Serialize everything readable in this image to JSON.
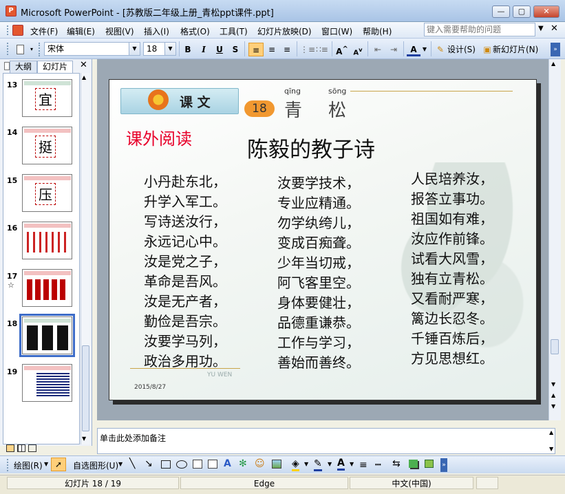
{
  "window": {
    "title": "Microsoft PowerPoint - [苏教版二年级上册_青松ppt课件.ppt]",
    "app_icon": "P"
  },
  "menu": {
    "items": [
      "文件(F)",
      "编辑(E)",
      "视图(V)",
      "插入(I)",
      "格式(O)",
      "工具(T)",
      "幻灯片放映(D)",
      "窗口(W)",
      "帮助(H)"
    ],
    "help_placeholder": "键入需要帮助的问题"
  },
  "toolbar": {
    "font": "宋体",
    "size": "18",
    "design_label": "设计(S)",
    "new_slide_label": "新幻灯片(N)"
  },
  "left_pane": {
    "tabs": [
      "大纲",
      "幻灯片"
    ],
    "thumbs": [
      {
        "num": "13",
        "glyph": "宜"
      },
      {
        "num": "14",
        "glyph": "挺"
      },
      {
        "num": "15",
        "glyph": "压"
      },
      {
        "num": "16",
        "glyph": ""
      },
      {
        "num": "17",
        "glyph": ""
      },
      {
        "num": "18",
        "glyph": ""
      },
      {
        "num": "19",
        "glyph": ""
      }
    ]
  },
  "slide": {
    "header_label": "课 文",
    "lesson_number": "18",
    "lesson_pinyin_1": "qīng",
    "lesson_pinyin_2": "sōng",
    "lesson_char_1": "青",
    "lesson_char_2": "松",
    "extra_reading": "课外阅读",
    "title": "陈毅的教子诗",
    "column1": [
      "小丹赴东北，",
      "升学入军工。",
      "写诗送汝行，",
      "永远记心中。",
      "汝是党之子，",
      "革命是吾风。",
      "汝是无产者，",
      "勤俭是吾宗。",
      "汝要学马列，",
      "政治多用功。"
    ],
    "column2": [
      "汝要学技术，",
      "专业应精通。",
      "勿学纨绔儿，",
      "变成百痴聋。",
      "少年当切戒，",
      "阿飞客里空。",
      "身体要健壮，",
      "品德重谦恭。",
      "工作与学习，",
      "善始而善终。"
    ],
    "column3": [
      "人民培养汝，",
      "报答立事功。",
      "祖国如有难，",
      "汝应作前锋。",
      "试看大风雪，",
      "独有立青松。",
      "又看耐严寒，",
      "篱边长忍冬。",
      "千锤百炼后，",
      "方见思想红。"
    ],
    "date": "2015/8/27",
    "footer": "YU WEN"
  },
  "notes": {
    "placeholder": "单击此处添加备注"
  },
  "draw_toolbar": {
    "draw_label": "绘图(R)",
    "autoshape_label": "自选图形(U)"
  },
  "status": {
    "slide_info": "幻灯片 18 / 19",
    "template": "Edge",
    "language": "中文(中国)"
  },
  "colors": {
    "accent_red": "#e8002a",
    "title_bar": "#a9c4e6"
  }
}
